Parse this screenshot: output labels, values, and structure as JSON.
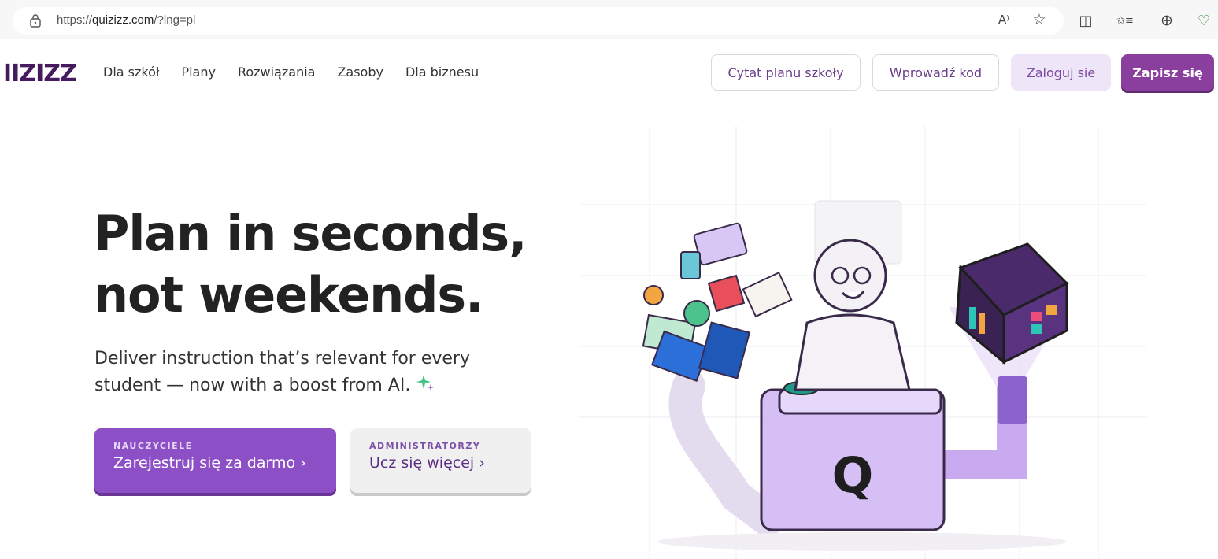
{
  "browser": {
    "url_scheme": "https://",
    "url_host": "quizizz.com",
    "url_path": "/?lng=pl",
    "icons": [
      "lock-icon",
      "read-aloud-icon",
      "favorite-star-icon",
      "split-screen-icon",
      "favorites-list-icon",
      "collections-icon",
      "browser-essentials-icon"
    ],
    "read_aloud_glyph": "A⁾",
    "star_glyph": "☆",
    "split_glyph": "◫",
    "favs_glyph": "✩≡",
    "collections_glyph": "⊕",
    "essentials_glyph": "♡"
  },
  "nav": {
    "logo": "IIZIZZ",
    "links": [
      "Dla szkół",
      "Plany",
      "Rozwiązania",
      "Zasoby",
      "Dla biznesu"
    ],
    "quote_button": "Cytat planu szkoły",
    "code_button": "Wprowadź kod",
    "login_button": "Zaloguj sie",
    "signup_button": "Zapisz się"
  },
  "hero": {
    "title_line1": "Plan in seconds,",
    "title_line2": "not weekends.",
    "subtitle": "Deliver instruction that’s relevant for every student — now with a boost from AI.",
    "teacher_cta": {
      "kicker": "NAUCZYCIELE",
      "label": "Zarejestruj się za darmo"
    },
    "admin_cta": {
      "kicker": "ADMINISTRATORZY",
      "label": "Ucz się więcej"
    },
    "chevron": "›"
  },
  "illustration": {
    "logo_glyph": "Q"
  },
  "colors": {
    "brand_purple": "#8d4fc5",
    "logo_dark": "#461a5f",
    "signup": "#8a3f9e",
    "login_bg": "#efe5f8"
  }
}
